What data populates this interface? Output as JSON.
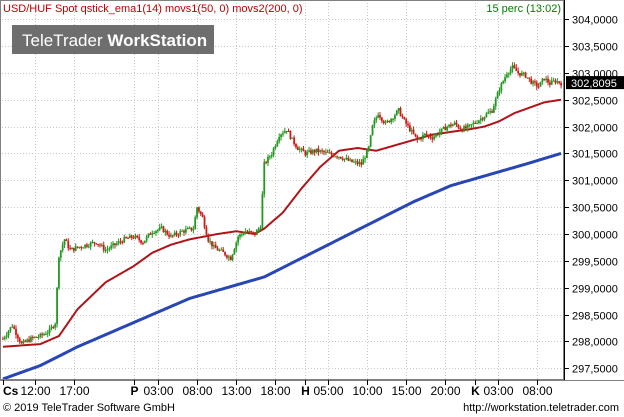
{
  "header": {
    "left_text": "USD/HUF Spot qstick_ema1(14) movs1(50, 0) movs2(200, 0)",
    "right_text": "15 perc (13:02)"
  },
  "watermark": {
    "normal": "TeleTrader ",
    "bold": "WorkStation"
  },
  "footer": {
    "copyright": "© 2019 TeleTrader Software GmbH",
    "url": "http://workstation.teletrader.com"
  },
  "colors": {
    "up_candle": "#1e9a1e",
    "down_candle": "#d01818",
    "ma50": "#b01418",
    "ma200": "#2846b4",
    "header_left": "#c00000",
    "header_right": "#008000",
    "last_price_bg": "#000000"
  },
  "chart_data": {
    "type": "candlestick",
    "instrument": "USD/HUF Spot",
    "interval": "15 perc",
    "last_price": 302.8095,
    "last_price_label": "302,8095",
    "ylim": [
      297.3,
      304.3
    ],
    "y_ticks": [
      {
        "value": 297.5,
        "label": "297,5000"
      },
      {
        "value": 298.0,
        "label": "298,0000"
      },
      {
        "value": 298.5,
        "label": "298,5000"
      },
      {
        "value": 299.0,
        "label": "299,0000"
      },
      {
        "value": 299.5,
        "label": "299,5000"
      },
      {
        "value": 300.0,
        "label": "300,0000"
      },
      {
        "value": 300.5,
        "label": "300,5000"
      },
      {
        "value": 301.0,
        "label": "301,0000"
      },
      {
        "value": 301.5,
        "label": "301,5000"
      },
      {
        "value": 302.0,
        "label": "302,0000"
      },
      {
        "value": 302.5,
        "label": "302,5000"
      },
      {
        "value": 303.0,
        "label": "303,0000"
      },
      {
        "value": 303.5,
        "label": "303,5000"
      },
      {
        "value": 304.0,
        "label": "304,0000"
      }
    ],
    "x_ticks": [
      {
        "label": "Cs",
        "bold": true,
        "idx": 0
      },
      {
        "label": "12:00",
        "bold": false,
        "idx": 17
      },
      {
        "label": "17:00",
        "bold": false,
        "idx": 38
      },
      {
        "label": "P",
        "bold": true,
        "idx": 70
      },
      {
        "label": "03:00",
        "bold": false,
        "idx": 83
      },
      {
        "label": "08:00",
        "bold": false,
        "idx": 104
      },
      {
        "label": "13:00",
        "bold": false,
        "idx": 125
      },
      {
        "label": "18:00",
        "bold": false,
        "idx": 146
      },
      {
        "label": "H",
        "bold": true,
        "idx": 162
      },
      {
        "label": "05:00",
        "bold": false,
        "idx": 174
      },
      {
        "label": "10:00",
        "bold": false,
        "idx": 195
      },
      {
        "label": "15:00",
        "bold": false,
        "idx": 216
      },
      {
        "label": "20:00",
        "bold": false,
        "idx": 237
      },
      {
        "label": "K",
        "bold": true,
        "idx": 253
      },
      {
        "label": "03:00",
        "bold": false,
        "idx": 265
      },
      {
        "label": "08:00",
        "bold": false,
        "idx": 286
      }
    ],
    "n_bars": 300,
    "price_keypoints": [
      [
        0,
        298.05
      ],
      [
        5,
        298.3
      ],
      [
        10,
        297.95
      ],
      [
        15,
        298.05
      ],
      [
        20,
        298.1
      ],
      [
        25,
        298.2
      ],
      [
        28,
        298.35
      ],
      [
        30,
        299.6
      ],
      [
        33,
        299.9
      ],
      [
        36,
        299.7
      ],
      [
        40,
        299.75
      ],
      [
        45,
        299.8
      ],
      [
        50,
        299.85
      ],
      [
        55,
        299.7
      ],
      [
        60,
        299.8
      ],
      [
        65,
        299.9
      ],
      [
        70,
        299.95
      ],
      [
        75,
        299.85
      ],
      [
        80,
        300.05
      ],
      [
        85,
        300.1
      ],
      [
        90,
        299.95
      ],
      [
        96,
        300.05
      ],
      [
        102,
        300.1
      ],
      [
        104,
        300.5
      ],
      [
        107,
        300.3
      ],
      [
        110,
        299.9
      ],
      [
        113,
        299.75
      ],
      [
        118,
        299.65
      ],
      [
        122,
        299.55
      ],
      [
        126,
        299.95
      ],
      [
        130,
        300.05
      ],
      [
        135,
        300.0
      ],
      [
        138,
        300.15
      ],
      [
        140,
        301.3
      ],
      [
        144,
        301.5
      ],
      [
        148,
        301.85
      ],
      [
        152,
        301.95
      ],
      [
        155,
        301.75
      ],
      [
        158,
        301.6
      ],
      [
        162,
        301.5
      ],
      [
        168,
        301.55
      ],
      [
        174,
        301.5
      ],
      [
        180,
        301.45
      ],
      [
        186,
        301.35
      ],
      [
        192,
        301.3
      ],
      [
        196,
        301.6
      ],
      [
        198,
        302.0
      ],
      [
        201,
        302.25
      ],
      [
        205,
        302.05
      ],
      [
        208,
        302.15
      ],
      [
        212,
        302.3
      ],
      [
        215,
        302.1
      ],
      [
        218,
        301.95
      ],
      [
        222,
        301.75
      ],
      [
        226,
        301.85
      ],
      [
        230,
        301.8
      ],
      [
        234,
        301.9
      ],
      [
        238,
        302.0
      ],
      [
        242,
        302.05
      ],
      [
        246,
        301.95
      ],
      [
        250,
        302.0
      ],
      [
        254,
        302.1
      ],
      [
        258,
        302.2
      ],
      [
        262,
        302.3
      ],
      [
        266,
        302.7
      ],
      [
        270,
        303.0
      ],
      [
        273,
        303.1
      ],
      [
        276,
        303.0
      ],
      [
        280,
        302.95
      ],
      [
        284,
        302.8
      ],
      [
        287,
        302.75
      ],
      [
        290,
        302.9
      ],
      [
        293,
        302.8
      ],
      [
        296,
        302.85
      ],
      [
        299,
        302.8095
      ]
    ],
    "ma50_keypoints": [
      [
        0,
        297.9
      ],
      [
        20,
        297.95
      ],
      [
        30,
        298.1
      ],
      [
        40,
        298.6
      ],
      [
        55,
        299.1
      ],
      [
        70,
        299.4
      ],
      [
        80,
        299.65
      ],
      [
        90,
        299.8
      ],
      [
        100,
        299.9
      ],
      [
        115,
        300.0
      ],
      [
        125,
        300.05
      ],
      [
        135,
        300.0
      ],
      [
        140,
        300.1
      ],
      [
        150,
        300.4
      ],
      [
        160,
        300.85
      ],
      [
        170,
        301.25
      ],
      [
        180,
        301.55
      ],
      [
        190,
        301.6
      ],
      [
        200,
        301.55
      ],
      [
        210,
        301.65
      ],
      [
        220,
        301.75
      ],
      [
        230,
        301.85
      ],
      [
        240,
        301.9
      ],
      [
        250,
        301.95
      ],
      [
        258,
        302.0
      ],
      [
        266,
        302.1
      ],
      [
        274,
        302.25
      ],
      [
        282,
        302.35
      ],
      [
        290,
        302.45
      ],
      [
        299,
        302.5
      ]
    ],
    "ma200_keypoints": [
      [
        0,
        297.3
      ],
      [
        20,
        297.55
      ],
      [
        40,
        297.9
      ],
      [
        60,
        298.2
      ],
      [
        80,
        298.5
      ],
      [
        100,
        298.8
      ],
      [
        120,
        299.0
      ],
      [
        140,
        299.2
      ],
      [
        160,
        299.55
      ],
      [
        180,
        299.9
      ],
      [
        200,
        300.25
      ],
      [
        220,
        300.6
      ],
      [
        240,
        300.9
      ],
      [
        260,
        301.1
      ],
      [
        280,
        301.3
      ],
      [
        299,
        301.5
      ]
    ]
  }
}
